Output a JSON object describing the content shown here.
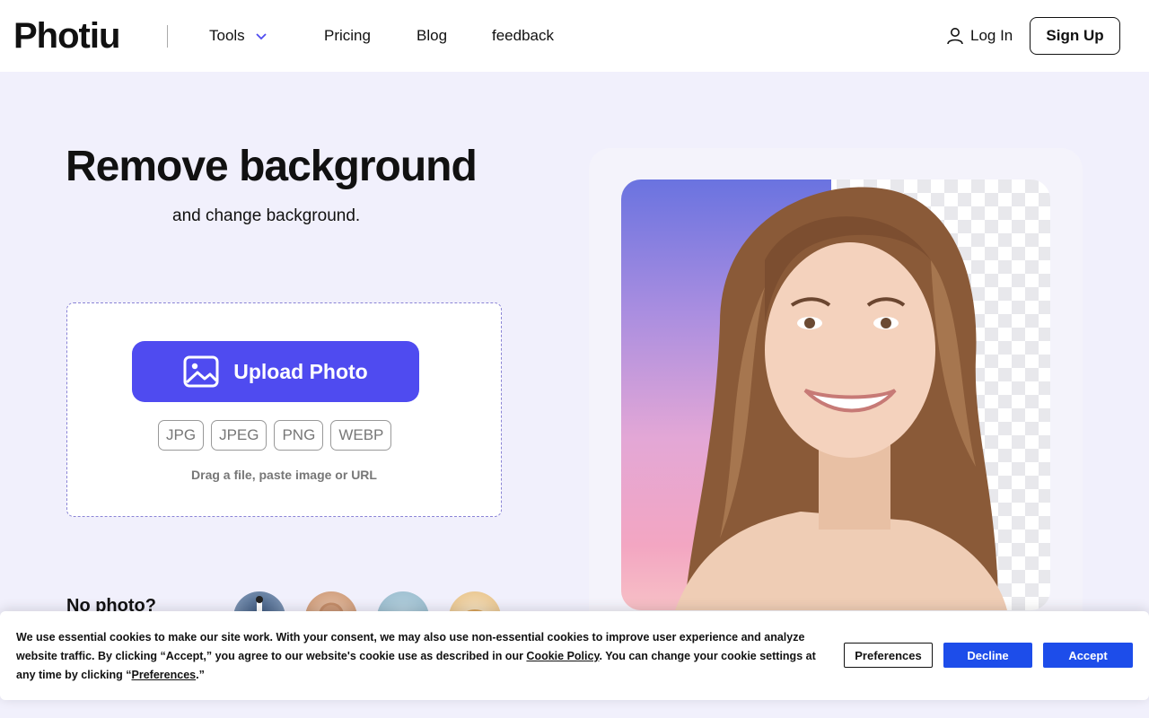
{
  "header": {
    "logo": "Photiu",
    "nav": {
      "tools": "Tools",
      "pricing": "Pricing",
      "blog": "Blog",
      "feedback": "feedback"
    },
    "login": "Log In",
    "signup": "Sign Up"
  },
  "hero": {
    "title": "Remove background",
    "subtitle": "and change background."
  },
  "upload": {
    "button_label": "Upload Photo",
    "formats": [
      "JPG",
      "JPEG",
      "PNG",
      "WEBP"
    ],
    "hint": "Drag a file,  paste image or URL"
  },
  "samples": {
    "label": "No photo?"
  },
  "cookie": {
    "text_part1": "We use essential cookies to make our site work. With your consent, we may also use non-essential cookies to improve user experience and analyze website traffic. By clicking “Accept,” you agree to our website's cookie use as described in our ",
    "policy_link": "Cookie Policy",
    "text_part2": ". You can change your cookie settings at any time by clicking “",
    "preferences_link": "Preferences",
    "text_part3": ".”",
    "btn_preferences": "Preferences",
    "btn_decline": "Decline",
    "btn_accept": "Accept"
  },
  "colors": {
    "brand": "#4f4bf0",
    "cookie_button": "#1d4dea",
    "page_background": "#f1f0fc"
  },
  "icons": {
    "tools_chevron": "chevron-down-icon",
    "login_user": "user-icon",
    "upload_image": "image-icon"
  }
}
